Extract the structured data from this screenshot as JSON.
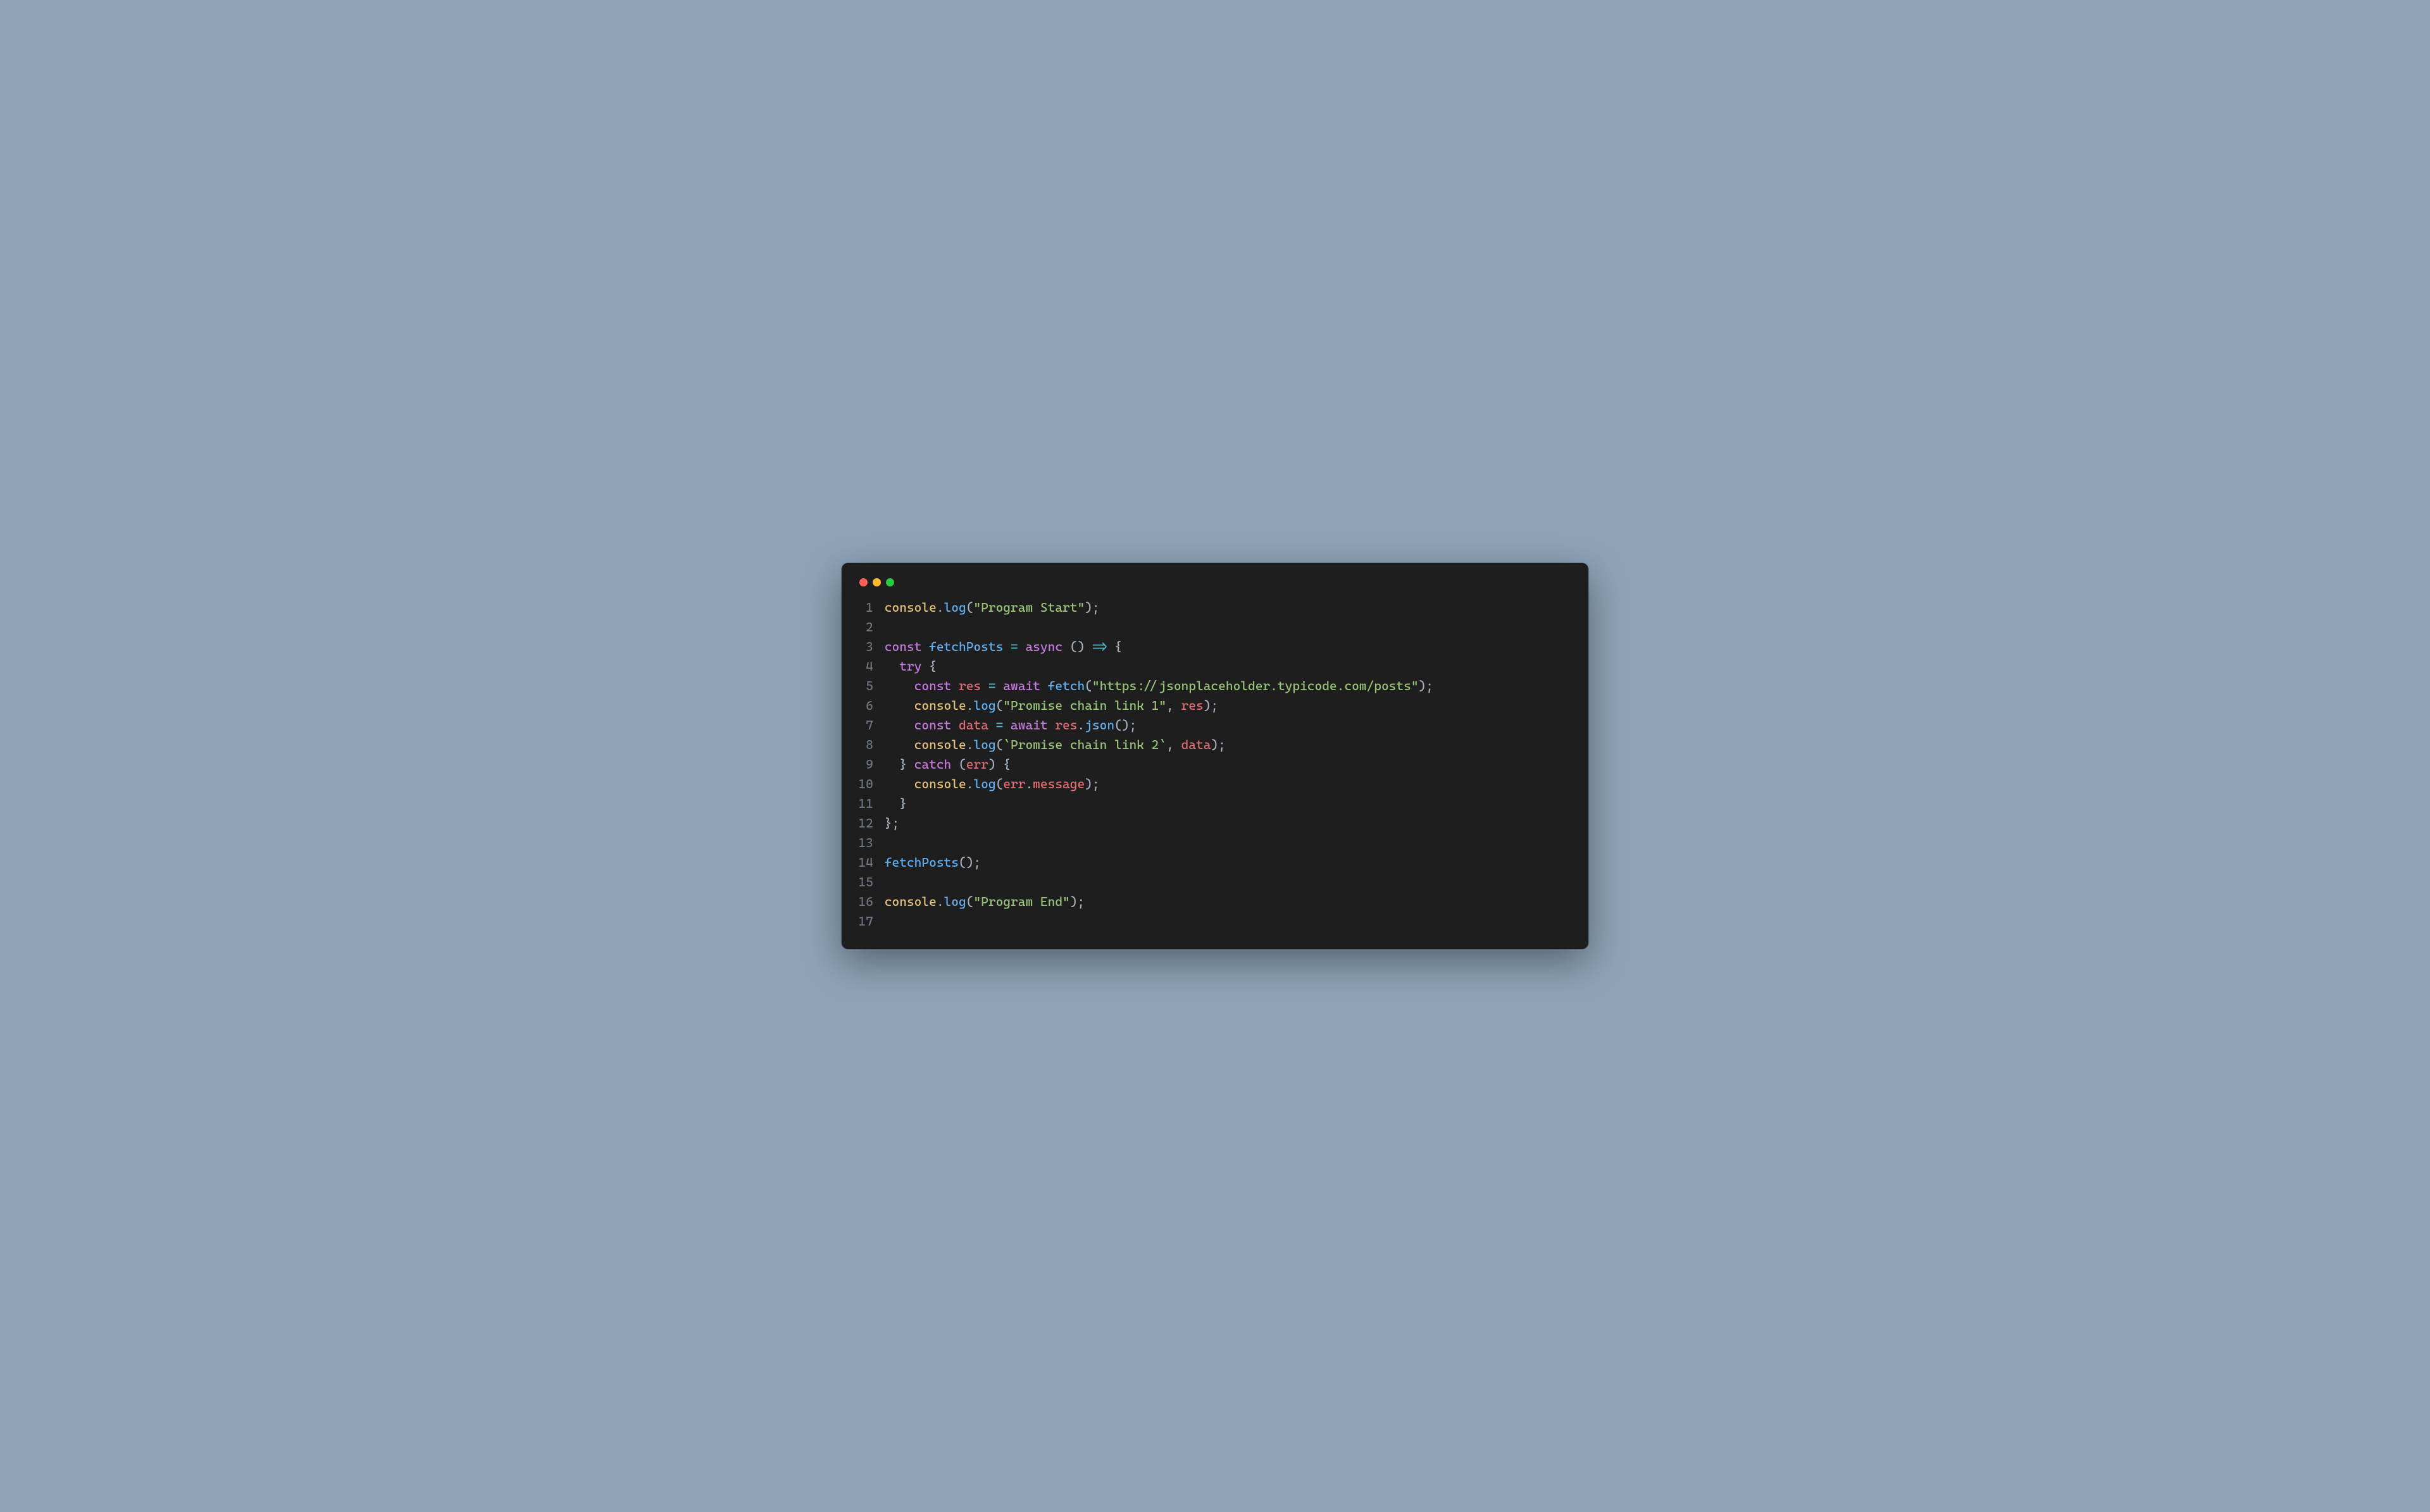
{
  "window": {
    "buttons": [
      "close",
      "minimize",
      "zoom"
    ]
  },
  "code": {
    "lines": [
      {
        "n": 1,
        "tokens": [
          {
            "c": "c-obj",
            "t": "console"
          },
          {
            "c": "c-plain",
            "t": "."
          },
          {
            "c": "c-fn",
            "t": "log"
          },
          {
            "c": "c-plain",
            "t": "("
          },
          {
            "c": "c-str",
            "t": "\"Program Start\""
          },
          {
            "c": "c-plain",
            "t": ");"
          }
        ]
      },
      {
        "n": 2,
        "tokens": []
      },
      {
        "n": 3,
        "tokens": [
          {
            "c": "c-kw",
            "t": "const"
          },
          {
            "c": "c-plain",
            "t": " "
          },
          {
            "c": "c-def",
            "t": "fetchPosts"
          },
          {
            "c": "c-plain",
            "t": " "
          },
          {
            "c": "c-op",
            "t": "="
          },
          {
            "c": "c-plain",
            "t": " "
          },
          {
            "c": "c-kw",
            "t": "async"
          },
          {
            "c": "c-plain",
            "t": " () "
          },
          {
            "c": "c-op",
            "t": "=>"
          },
          {
            "c": "c-plain",
            "t": " {"
          }
        ]
      },
      {
        "n": 4,
        "tokens": [
          {
            "c": "c-plain",
            "t": "  "
          },
          {
            "c": "c-kw",
            "t": "try"
          },
          {
            "c": "c-plain",
            "t": " {"
          }
        ]
      },
      {
        "n": 5,
        "tokens": [
          {
            "c": "c-plain",
            "t": "    "
          },
          {
            "c": "c-kw",
            "t": "const"
          },
          {
            "c": "c-plain",
            "t": " "
          },
          {
            "c": "c-name",
            "t": "res"
          },
          {
            "c": "c-plain",
            "t": " "
          },
          {
            "c": "c-op",
            "t": "="
          },
          {
            "c": "c-plain",
            "t": " "
          },
          {
            "c": "c-kw",
            "t": "await"
          },
          {
            "c": "c-plain",
            "t": " "
          },
          {
            "c": "c-fn",
            "t": "fetch"
          },
          {
            "c": "c-plain",
            "t": "("
          },
          {
            "c": "c-str",
            "t": "\"https://jsonplaceholder.typicode.com/posts\""
          },
          {
            "c": "c-plain",
            "t": ");"
          }
        ]
      },
      {
        "n": 6,
        "tokens": [
          {
            "c": "c-plain",
            "t": "    "
          },
          {
            "c": "c-obj",
            "t": "console"
          },
          {
            "c": "c-plain",
            "t": "."
          },
          {
            "c": "c-fn",
            "t": "log"
          },
          {
            "c": "c-plain",
            "t": "("
          },
          {
            "c": "c-str",
            "t": "\"Promise chain link 1\""
          },
          {
            "c": "c-plain",
            "t": ", "
          },
          {
            "c": "c-name",
            "t": "res"
          },
          {
            "c": "c-plain",
            "t": ");"
          }
        ]
      },
      {
        "n": 7,
        "tokens": [
          {
            "c": "c-plain",
            "t": "    "
          },
          {
            "c": "c-kw",
            "t": "const"
          },
          {
            "c": "c-plain",
            "t": " "
          },
          {
            "c": "c-name",
            "t": "data"
          },
          {
            "c": "c-plain",
            "t": " "
          },
          {
            "c": "c-op",
            "t": "="
          },
          {
            "c": "c-plain",
            "t": " "
          },
          {
            "c": "c-kw",
            "t": "await"
          },
          {
            "c": "c-plain",
            "t": " "
          },
          {
            "c": "c-name",
            "t": "res"
          },
          {
            "c": "c-plain",
            "t": "."
          },
          {
            "c": "c-fn",
            "t": "json"
          },
          {
            "c": "c-plain",
            "t": "();"
          }
        ]
      },
      {
        "n": 8,
        "tokens": [
          {
            "c": "c-plain",
            "t": "    "
          },
          {
            "c": "c-obj",
            "t": "console"
          },
          {
            "c": "c-plain",
            "t": "."
          },
          {
            "c": "c-fn",
            "t": "log"
          },
          {
            "c": "c-plain",
            "t": "("
          },
          {
            "c": "c-str",
            "t": "`Promise chain link 2`"
          },
          {
            "c": "c-plain",
            "t": ", "
          },
          {
            "c": "c-name",
            "t": "data"
          },
          {
            "c": "c-plain",
            "t": ");"
          }
        ]
      },
      {
        "n": 9,
        "tokens": [
          {
            "c": "c-plain",
            "t": "  } "
          },
          {
            "c": "c-kw",
            "t": "catch"
          },
          {
            "c": "c-plain",
            "t": " ("
          },
          {
            "c": "c-name",
            "t": "err"
          },
          {
            "c": "c-plain",
            "t": ") {"
          }
        ]
      },
      {
        "n": 10,
        "tokens": [
          {
            "c": "c-plain",
            "t": "    "
          },
          {
            "c": "c-obj",
            "t": "console"
          },
          {
            "c": "c-plain",
            "t": "."
          },
          {
            "c": "c-fn",
            "t": "log"
          },
          {
            "c": "c-plain",
            "t": "("
          },
          {
            "c": "c-name",
            "t": "err"
          },
          {
            "c": "c-plain",
            "t": "."
          },
          {
            "c": "c-name",
            "t": "message"
          },
          {
            "c": "c-plain",
            "t": ");"
          }
        ]
      },
      {
        "n": 11,
        "tokens": [
          {
            "c": "c-plain",
            "t": "  }"
          }
        ]
      },
      {
        "n": 12,
        "tokens": [
          {
            "c": "c-plain",
            "t": "};"
          }
        ]
      },
      {
        "n": 13,
        "tokens": []
      },
      {
        "n": 14,
        "tokens": [
          {
            "c": "c-fn",
            "t": "fetchPosts"
          },
          {
            "c": "c-plain",
            "t": "();"
          }
        ]
      },
      {
        "n": 15,
        "tokens": []
      },
      {
        "n": 16,
        "tokens": [
          {
            "c": "c-obj",
            "t": "console"
          },
          {
            "c": "c-plain",
            "t": "."
          },
          {
            "c": "c-fn",
            "t": "log"
          },
          {
            "c": "c-plain",
            "t": "("
          },
          {
            "c": "c-str",
            "t": "\"Program End\""
          },
          {
            "c": "c-plain",
            "t": ");"
          }
        ]
      },
      {
        "n": 17,
        "tokens": []
      }
    ]
  }
}
